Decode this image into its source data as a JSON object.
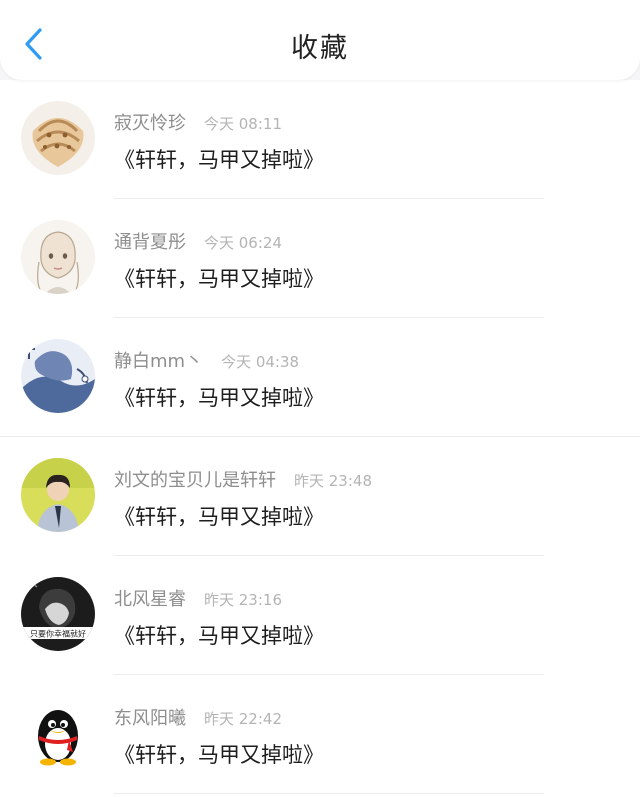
{
  "header": {
    "title": "收藏",
    "back_icon": "chevron-left-icon",
    "accent": "#2f9bf3"
  },
  "items": [
    {
      "name": "寂灭怜珍",
      "time": "今天 08:11",
      "message": "《轩轩，马甲又掉啦》",
      "avatar": "seashell-avatar"
    },
    {
      "name": "通背夏彤",
      "time": "今天 06:24",
      "message": "《轩轩，马甲又掉啦》",
      "avatar": "sketch-girl-avatar"
    },
    {
      "name": "静白mm丶",
      "time": "今天 04:38",
      "message": "《轩轩，马甲又掉啦》",
      "avatar": "blue-illustration-avatar"
    },
    {
      "name": "刘文的宝贝儿是轩轩",
      "time": "昨天 23:48",
      "message": "《轩轩，马甲又掉啦》",
      "avatar": "boy-photo-avatar"
    },
    {
      "name": "北风星睿",
      "time": "昨天 23:16",
      "message": "《轩轩，马甲又掉啦》",
      "avatar": "bw-portrait-avatar",
      "avatar_caption": "只要你幸福就好"
    },
    {
      "name": "东风阳曦",
      "time": "昨天 22:42",
      "message": "《轩轩，马甲又掉啦》",
      "avatar": "penguin-avatar"
    }
  ]
}
